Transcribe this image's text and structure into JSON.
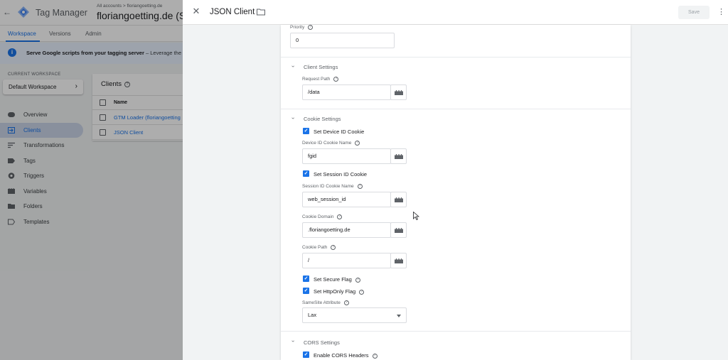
{
  "app": {
    "title": "Tag Manager",
    "breadcrumb": "All accounts > floriangoetting.de",
    "container": "floriangoetting.de (Server)"
  },
  "nav_tabs": [
    {
      "label": "Workspace",
      "active": true
    },
    {
      "label": "Versions"
    },
    {
      "label": "Admin"
    }
  ],
  "banner": {
    "bold": "Serve Google scripts from your tagging server",
    "rest": " – Leverage the d"
  },
  "workspace": {
    "label": "CURRENT WORKSPACE",
    "name": "Default Workspace"
  },
  "sidebar": {
    "items": [
      {
        "label": "Overview",
        "icon": "overview-icon"
      },
      {
        "label": "Clients",
        "icon": "clients-icon",
        "active": true
      },
      {
        "label": "Transformations",
        "icon": "transformations-icon"
      },
      {
        "label": "Tags",
        "icon": "tags-icon"
      },
      {
        "label": "Triggers",
        "icon": "triggers-icon"
      },
      {
        "label": "Variables",
        "icon": "variables-icon"
      },
      {
        "label": "Folders",
        "icon": "folder-icon"
      },
      {
        "label": "Templates",
        "icon": "templates-icon"
      }
    ]
  },
  "clients_list": {
    "title": "Clients",
    "column_name": "Name",
    "rows": [
      "GTM Loader (floriangoetting",
      "JSON Client"
    ]
  },
  "panel": {
    "title": "JSON Client",
    "save_label": "Save",
    "priority": {
      "label": "Priority",
      "value": "0"
    },
    "client_settings": {
      "title": "Client Settings",
      "request_path_label": "Request Path",
      "request_path_value": "/data"
    },
    "cookie_settings": {
      "title": "Cookie Settings",
      "device_id_checkbox": "Set Device ID Cookie",
      "device_id_name_label": "Device ID Cookie Name",
      "device_id_name_value": "fgid",
      "session_id_checkbox": "Set Session ID Cookie",
      "session_id_name_label": "Session ID Cookie Name",
      "session_id_name_value": "web_session_id",
      "domain_label": "Cookie Domain",
      "domain_value": ".floriangoetting.de",
      "path_label": "Cookie Path",
      "path_value": "/",
      "secure_checkbox": "Set Secure Flag",
      "httponly_checkbox": "Set HttpOnly Flag",
      "samesite_label": "SameSite Attribute",
      "samesite_value": "Lax"
    },
    "cors_settings": {
      "title": "CORS Settings",
      "enable_checkbox": "Enable CORS Headers"
    }
  },
  "colors": {
    "accent": "#1a73e8",
    "overlay": "rgba(0,0,0,0.32)"
  }
}
